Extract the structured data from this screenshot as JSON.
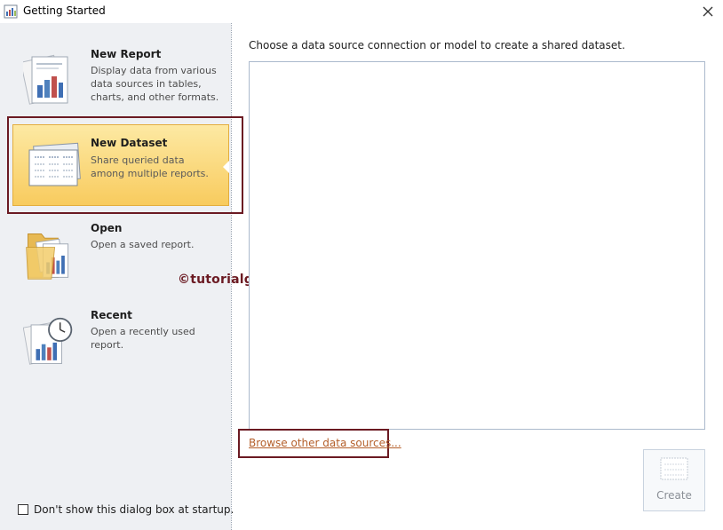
{
  "window": {
    "title": "Getting Started",
    "close_glyph": "×"
  },
  "sidebar": {
    "items": [
      {
        "label": "New Report",
        "description": "Display data from various data sources in tables, charts, and other formats.",
        "icon": "report-icon"
      },
      {
        "label": "New Dataset",
        "description": "Share queried data among multiple reports.",
        "icon": "dataset-icon",
        "selected": true
      },
      {
        "label": "Open",
        "description": "Open a saved report.",
        "icon": "folder-icon"
      },
      {
        "label": "Recent",
        "description": "Open a recently used report.",
        "icon": "recent-clock-icon"
      }
    ],
    "checkbox": {
      "label": "Don't show this dialog box at startup.",
      "checked": false
    }
  },
  "main": {
    "instruction": "Choose a data source connection or model to create a shared dataset.",
    "browse_link": "Browse other data sources...",
    "create_button": "Create"
  },
  "watermark": "©tutorialgateway.org",
  "colors": {
    "selection_bg": "#fcd97a",
    "highlight_border": "#6b1a22",
    "link": "#b45f2a",
    "sidebar_bg": "#eef0f3"
  }
}
